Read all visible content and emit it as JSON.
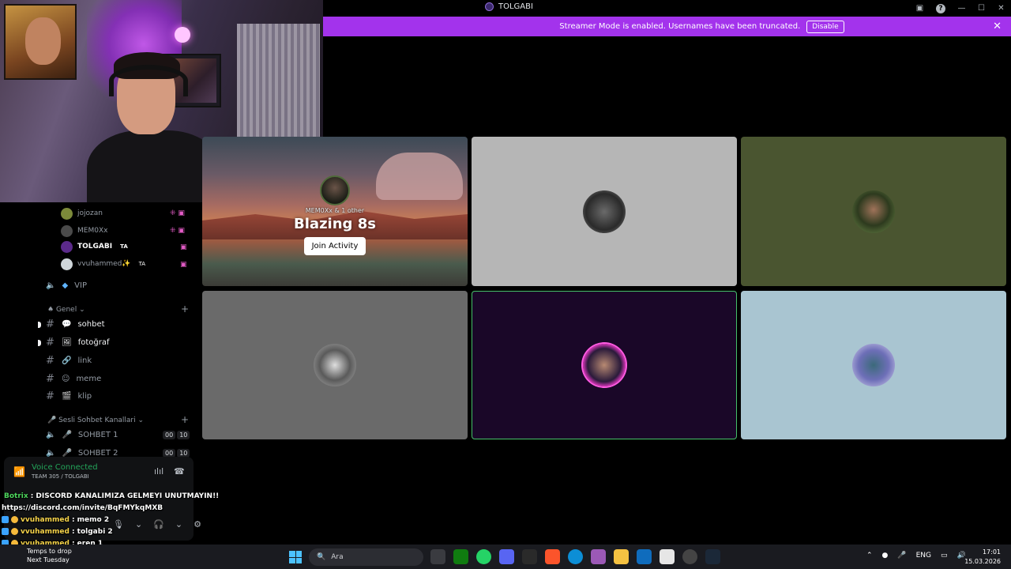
{
  "window": {
    "title": "TOLGABI"
  },
  "banner": {
    "text": "Streamer Mode is enabled. Usernames have been truncated.",
    "button": "Disable"
  },
  "voice_users": [
    {
      "name": "jojozan",
      "tag": ""
    },
    {
      "name": "MEM0Xx",
      "tag": ""
    },
    {
      "name": "TOLGABI",
      "tag": "TA"
    },
    {
      "name": "vvuhammed✨",
      "tag": "TA"
    }
  ],
  "channels": {
    "vip": "VIP",
    "category_general": "Genel",
    "text": [
      {
        "label": "sohbet",
        "unread": true
      },
      {
        "label": "fotoğraf",
        "unread": true
      },
      {
        "label": "link",
        "unread": false
      },
      {
        "label": "meme",
        "unread": false
      },
      {
        "label": "klip",
        "unread": false
      }
    ],
    "category_voice": "Sesli Sohbet Kanallari",
    "voice": [
      {
        "label": "SOHBET 1",
        "a": "00",
        "b": "10"
      },
      {
        "label": "SOHBET 2",
        "a": "00",
        "b": "10"
      }
    ]
  },
  "voice_panel": {
    "status": "Voice Connected",
    "location": "TEAM 305 / TOLGABI"
  },
  "chat": [
    {
      "user": "Botrix",
      "message": ": DISCORD KANALIMIZA GELMEYI UNUTMAYIN!!",
      "color": "#4dd65c"
    },
    {
      "user": "",
      "message": "https://discord.com/invite/BqFMYkqMXB",
      "color": "#ffffff"
    },
    {
      "user": "vvuhammed",
      "message": ": memo 2",
      "color": "#f5d34a"
    },
    {
      "user": "vvuhammed",
      "message": ": tolgabi 2",
      "color": "#f5d34a"
    },
    {
      "user": "vvuhammed",
      "message": ": eren 1",
      "color": "#f5d34a"
    }
  ],
  "activity_tile": {
    "who": "MEM0Xx & 1 other",
    "game": "Blazing 8s",
    "join": "Join Activity"
  },
  "taskbar": {
    "weather_line1": "Temps to drop",
    "weather_line2": "Next Tuesday",
    "search_placeholder": "Ara",
    "lang": "ENG",
    "time": "17:01",
    "date": "15.03.2026"
  },
  "colors": {
    "banner": "#a333ec",
    "voice_connected": "#23a55a",
    "speaking_border": "#45c06a"
  }
}
